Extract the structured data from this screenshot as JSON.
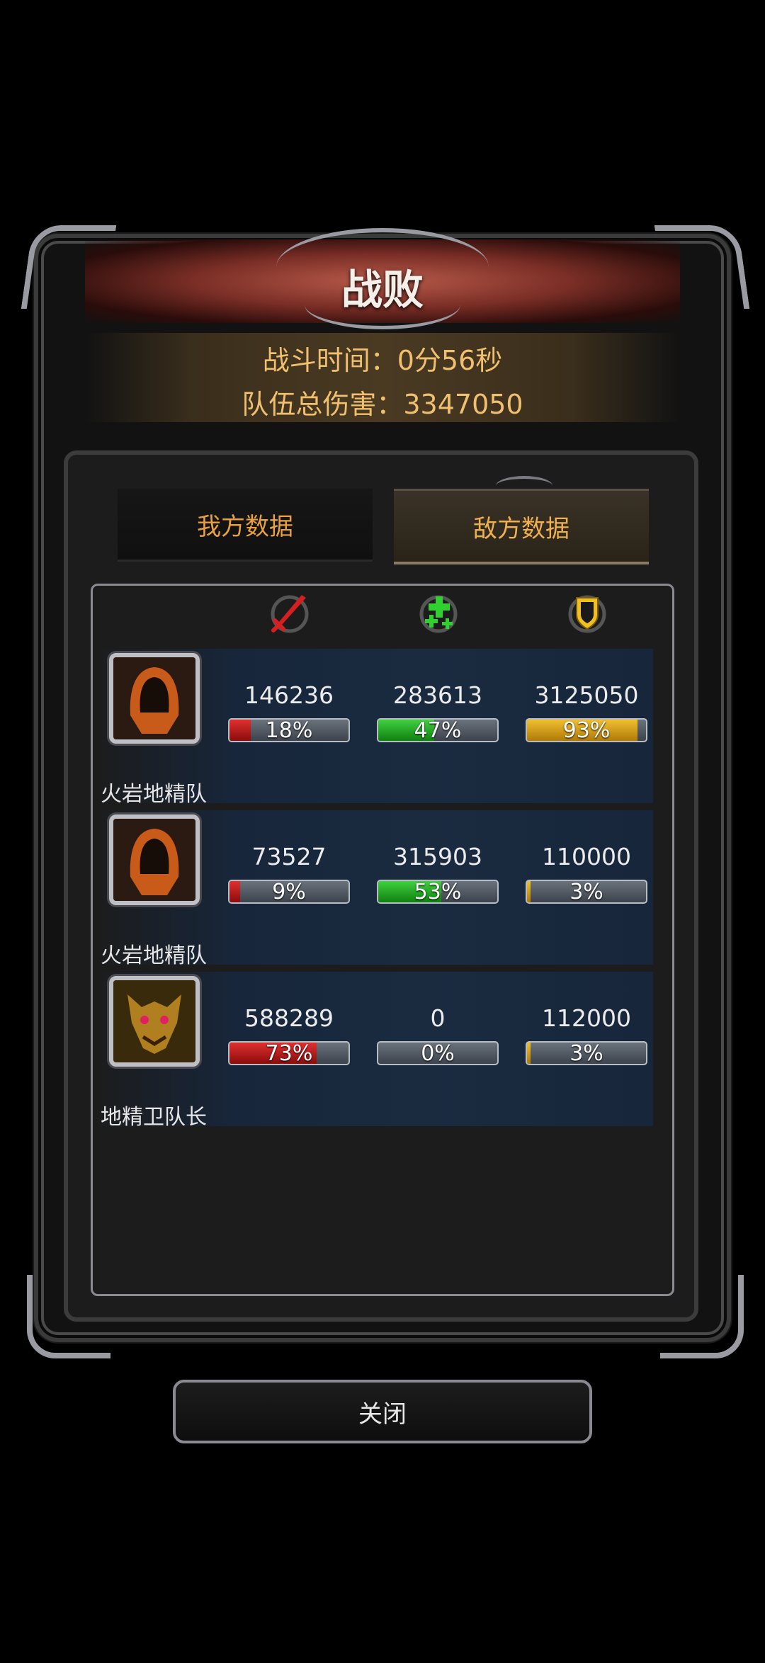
{
  "title": "战败",
  "battle_time": "战斗时间：0分56秒",
  "team_damage": "队伍总伤害：3347050",
  "tabs": {
    "ours": "我方数据",
    "enemy": "敌方数据",
    "active": "enemy"
  },
  "columns": {
    "damage_icon": "red-sword-icon",
    "heal_icon": "green-cross-icon",
    "defense_icon": "gold-shield-icon"
  },
  "rows": [
    {
      "name": "火岩地精队",
      "avatar": "hooded-goblin-icon",
      "damage": {
        "value": "146236",
        "percent": "18%",
        "fraction": 0.18
      },
      "heal": {
        "value": "283613",
        "percent": "47%",
        "fraction": 0.47
      },
      "defense": {
        "value": "3125050",
        "percent": "93%",
        "fraction": 0.93
      }
    },
    {
      "name": "火岩地精队",
      "avatar": "hooded-goblin-icon",
      "damage": {
        "value": "73527",
        "percent": "9%",
        "fraction": 0.09
      },
      "heal": {
        "value": "315903",
        "percent": "53%",
        "fraction": 0.53
      },
      "defense": {
        "value": "110000",
        "percent": "3%",
        "fraction": 0.03
      }
    },
    {
      "name": "地精卫队长",
      "avatar": "golden-beast-icon",
      "damage": {
        "value": "588289",
        "percent": "73%",
        "fraction": 0.73
      },
      "heal": {
        "value": "0",
        "percent": "0%",
        "fraction": 0
      },
      "defense": {
        "value": "112000",
        "percent": "3%",
        "fraction": 0.03
      }
    }
  ],
  "close_label": "关闭",
  "colors": {
    "damage": "#c41a1a",
    "heal": "#20b020",
    "defense": "#e0a818",
    "tab_text": "#e8a040",
    "info_text": "#f0c070"
  }
}
